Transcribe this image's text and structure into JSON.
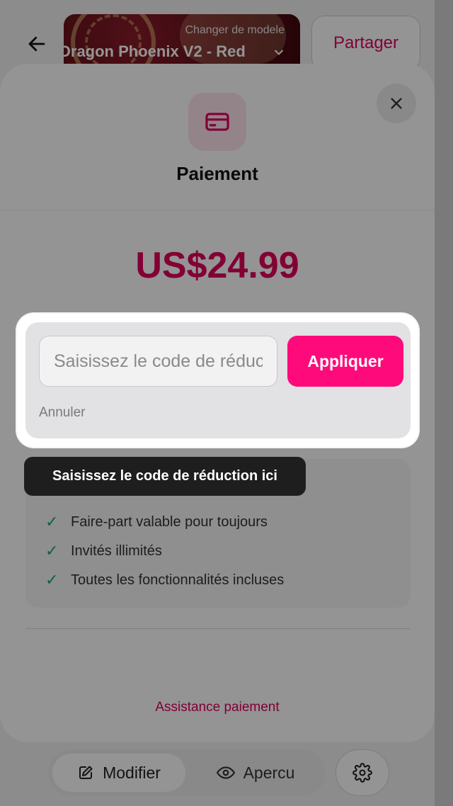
{
  "header": {
    "template_hint": "Changer de modele",
    "template_name": "Dragon Phoenix V2 - Red",
    "share_label": "Partager"
  },
  "modal": {
    "title": "Paiement",
    "price": "US$24.99",
    "features": [
      "Faire-part valable pour toujours",
      "Invités illimités",
      "Toutes les fonctionnalités incluses"
    ],
    "support_link": "Assistance paiement"
  },
  "promo": {
    "placeholder": "Saisissez le code de réduction",
    "apply_label": "Appliquer",
    "cancel_label": "Annuler",
    "tooltip": "Saisissez le code de réduction ici"
  },
  "bottom_nav": {
    "modify_label": "Modifier",
    "preview_label": "Apercu"
  },
  "colors": {
    "accent": "#e0005a",
    "apply_button": "#ff0a7a",
    "check": "#1ea672"
  },
  "icons": [
    "back-arrow-icon",
    "chevron-down-icon",
    "close-icon",
    "credit-card-icon",
    "check-icon",
    "edit-icon",
    "eye-icon",
    "gear-icon"
  ]
}
